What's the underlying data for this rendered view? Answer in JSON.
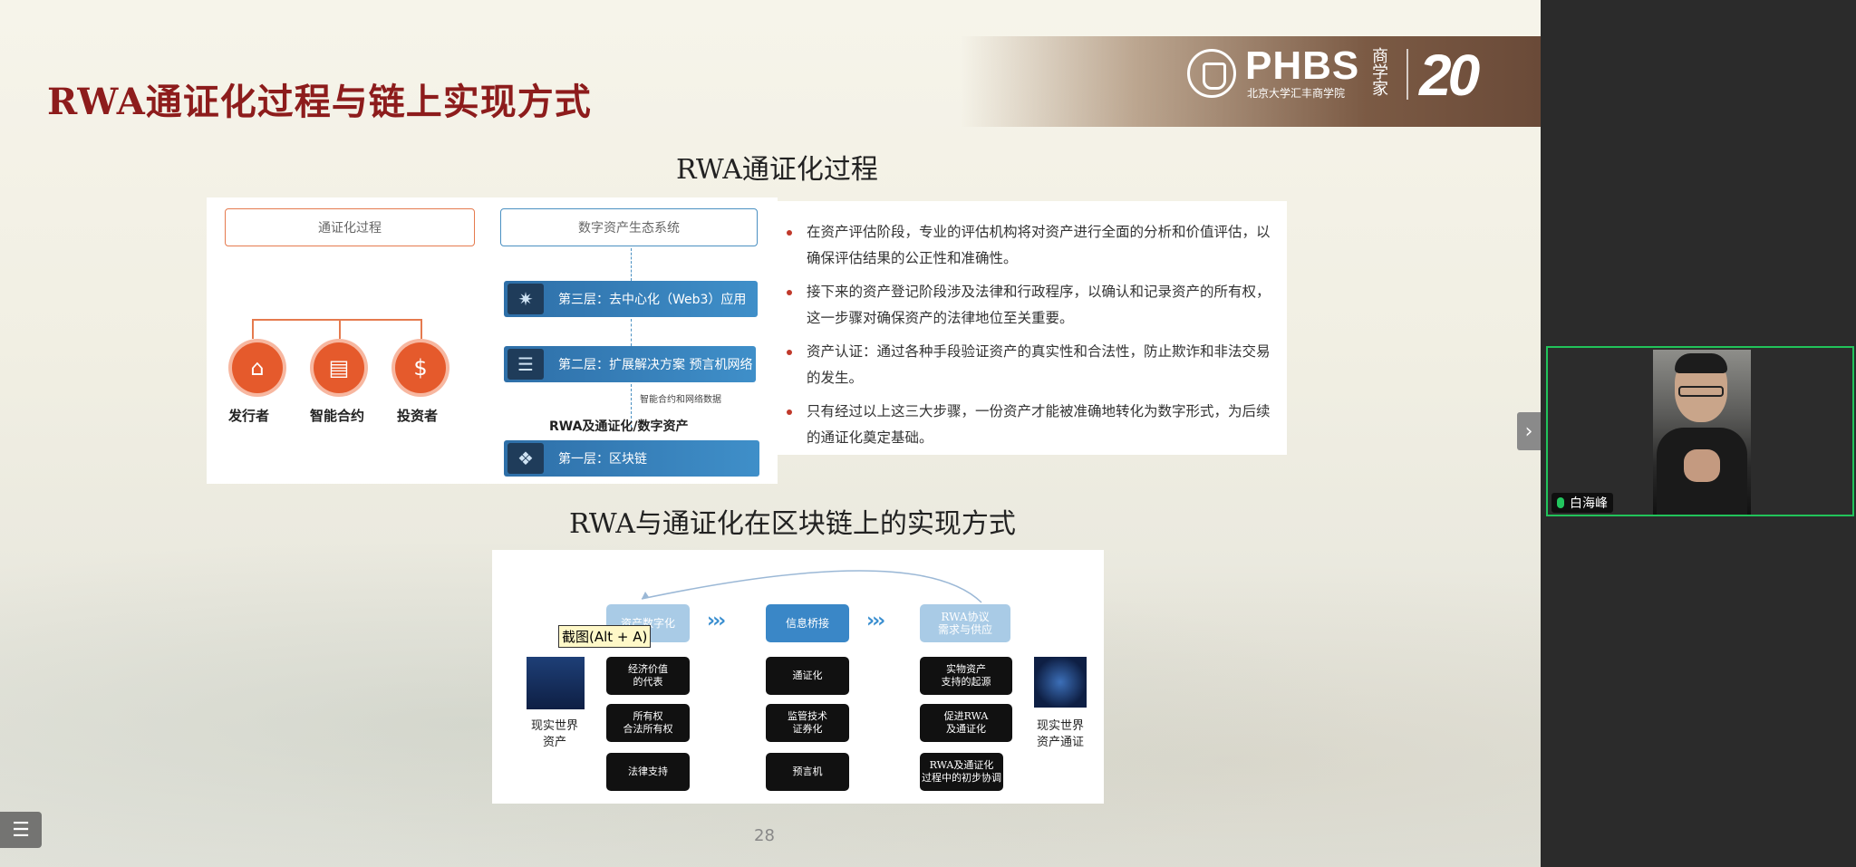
{
  "slide": {
    "title": "RWA通证化过程与链上实现方式",
    "header": {
      "brand": "PHBS",
      "brand_sub": "北京大学汇丰商学院",
      "calligraphy": "商学家",
      "anniversary": "20"
    },
    "page_number": "28"
  },
  "section1": {
    "title": "RWA通证化过程",
    "left_box": "通证化过程",
    "right_box": "数字资产生态系统",
    "actors": [
      "发行者",
      "智能合约",
      "投资者"
    ],
    "layers": [
      "第三层：去中心化（Web3）应用",
      "第二层：扩展解决方案 预言机网络",
      "第一层：区块链"
    ],
    "link_label": "智能合约和网络数据",
    "asset_label": "RWA及通证化/数字资产",
    "bullets": [
      "在资产评估阶段，专业的评估机构将对资产进行全面的分析和价值评估，以确保评估结果的公正性和准确性。",
      "接下来的资产登记阶段涉及法律和行政程序，以确认和记录资产的所有权，这一步骤对确保资产的法律地位至关重要。",
      "资产认证：通过各种手段验证资产的真实性和合法性，防止欺诈和非法交易的发生。",
      "只有经过以上这三大步骤，一份资产才能被准确地转化为数字形式，为后续的通证化奠定基础。"
    ]
  },
  "section2": {
    "title": "RWA与通证化在区块链上的实现方式",
    "left_label": "现实世界\n资产",
    "right_label": "现实世界\n资产通证",
    "col1_header": "资产数字化",
    "col2_header": "信息桥接",
    "col3_header": "RWA协议\n需求与供应",
    "col1": [
      "经济价值\n的代表",
      "所有权\n合法所有权",
      "法律支持"
    ],
    "col2": [
      "通证化",
      "监管技术\n证券化",
      "预言机"
    ],
    "col3": [
      "实物资产\n支持的起源",
      "促进RWA\n及通证化",
      "RWA及通证化\n过程中的初步协调"
    ]
  },
  "overlay": {
    "tooltip": "截图(Alt + A)"
  },
  "participant": {
    "name": "白海峰"
  },
  "colors": {
    "title_red": "#8d1c1c",
    "accent_orange": "#e55a2c",
    "layer_blue": "#2e6fa8",
    "active_green": "#21c35a"
  }
}
